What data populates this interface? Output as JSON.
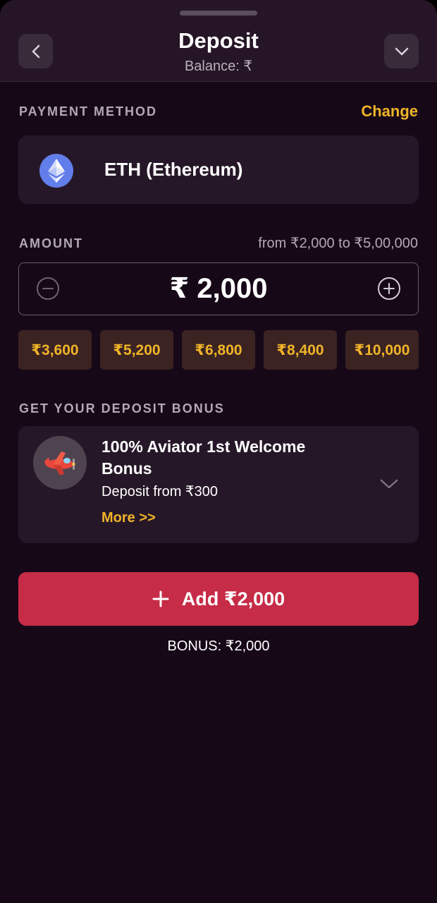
{
  "header": {
    "title": "Deposit",
    "balance": "Balance: ₹",
    "back_icon": "chevron-left-icon",
    "collapse_icon": "chevron-down-icon"
  },
  "payment": {
    "label": "PAYMENT METHOD",
    "change_link": "Change",
    "method_name": "ETH (Ethereum)",
    "method_icon": "ethereum-icon"
  },
  "amount": {
    "label": "AMOUNT",
    "range": "from ₹2,000 to ₹5,00,000",
    "value": "₹ 2,000",
    "decrease_icon": "minus-circle-icon",
    "increase_icon": "plus-circle-icon",
    "presets": [
      "₹3,600",
      "₹5,200",
      "₹6,800",
      "₹8,400",
      "₹10,000"
    ]
  },
  "bonus": {
    "label": "GET YOUR DEPOSIT BONUS",
    "title": "100% Aviator 1st Welcome Bonus",
    "subtitle": "Deposit from ₹300",
    "more": "More >>",
    "image_icon": "airplane-icon",
    "expand_icon": "chevron-down-icon"
  },
  "submit": {
    "label": "Add ₹2,000",
    "icon": "plus-icon"
  },
  "bonus_total": "BONUS: ₹2,000",
  "colors": {
    "background": "#170818",
    "card": "#261728",
    "accent_gold": "#f0b429",
    "primary_button": "#c62c47",
    "ethereum": "#627eea"
  }
}
